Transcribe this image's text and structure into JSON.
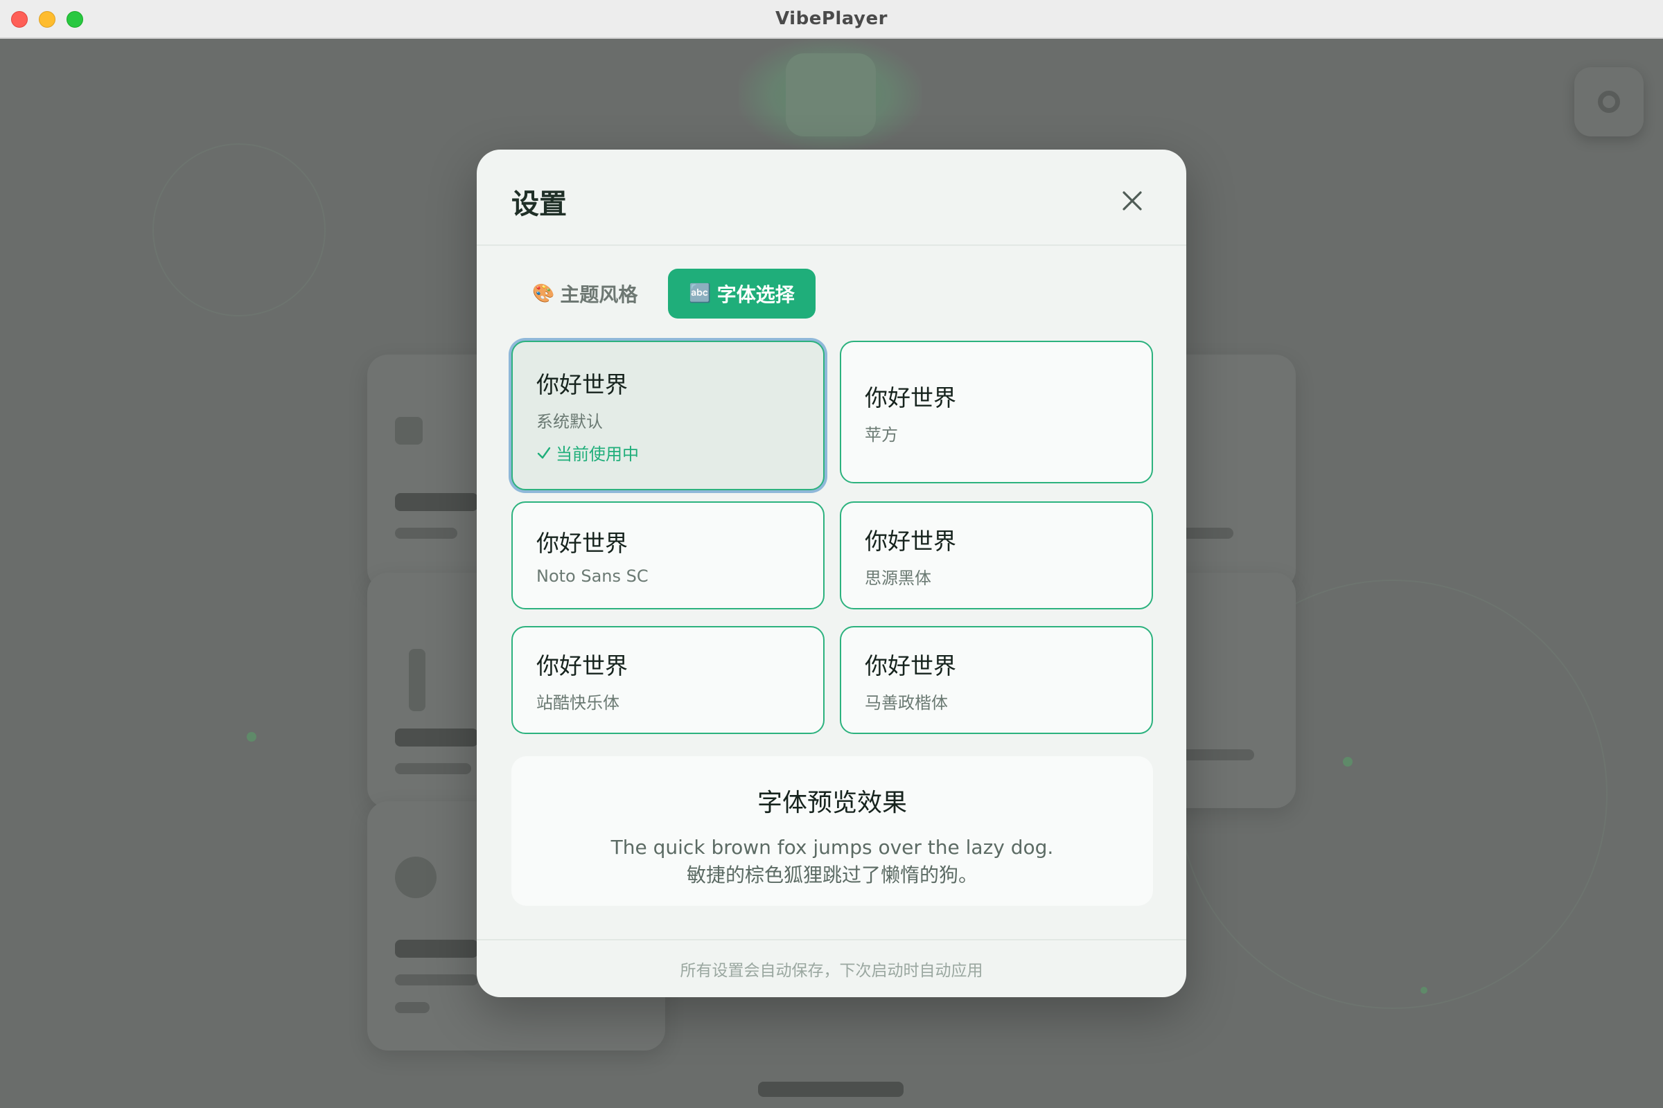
{
  "window": {
    "title": "VibePlayer"
  },
  "modal": {
    "title": "设置",
    "close_icon": "close-icon",
    "tabs": [
      {
        "icon": "🎨",
        "label": "主题风格",
        "active": false
      },
      {
        "icon": "🔤",
        "label": "字体选择",
        "active": true
      }
    ],
    "fonts": [
      {
        "sample": "你好世界",
        "name": "系统默认",
        "selected": true,
        "status": "当前使用中"
      },
      {
        "sample": "你好世界",
        "name": "苹方",
        "selected": false
      },
      {
        "sample": "你好世界",
        "name": "Noto Sans SC",
        "selected": false
      },
      {
        "sample": "你好世界",
        "name": "思源黑体",
        "selected": false
      },
      {
        "sample": "你好世界",
        "name": "站酷快乐体",
        "selected": false
      },
      {
        "sample": "你好世界",
        "name": "马善政楷体",
        "selected": false
      }
    ],
    "preview": {
      "title": "字体预览效果",
      "line1": "The quick brown fox jumps over the lazy dog.",
      "line2": "敏捷的棕色狐狸跳过了懒惰的狗。"
    },
    "footer": "所有设置会自动保存，下次启动时自动应用"
  },
  "colors": {
    "accent": "#1fae7a",
    "card_border": "#2cb27e",
    "selected_ring": "#8fb8d9",
    "overlay": "#6a6d6b"
  }
}
